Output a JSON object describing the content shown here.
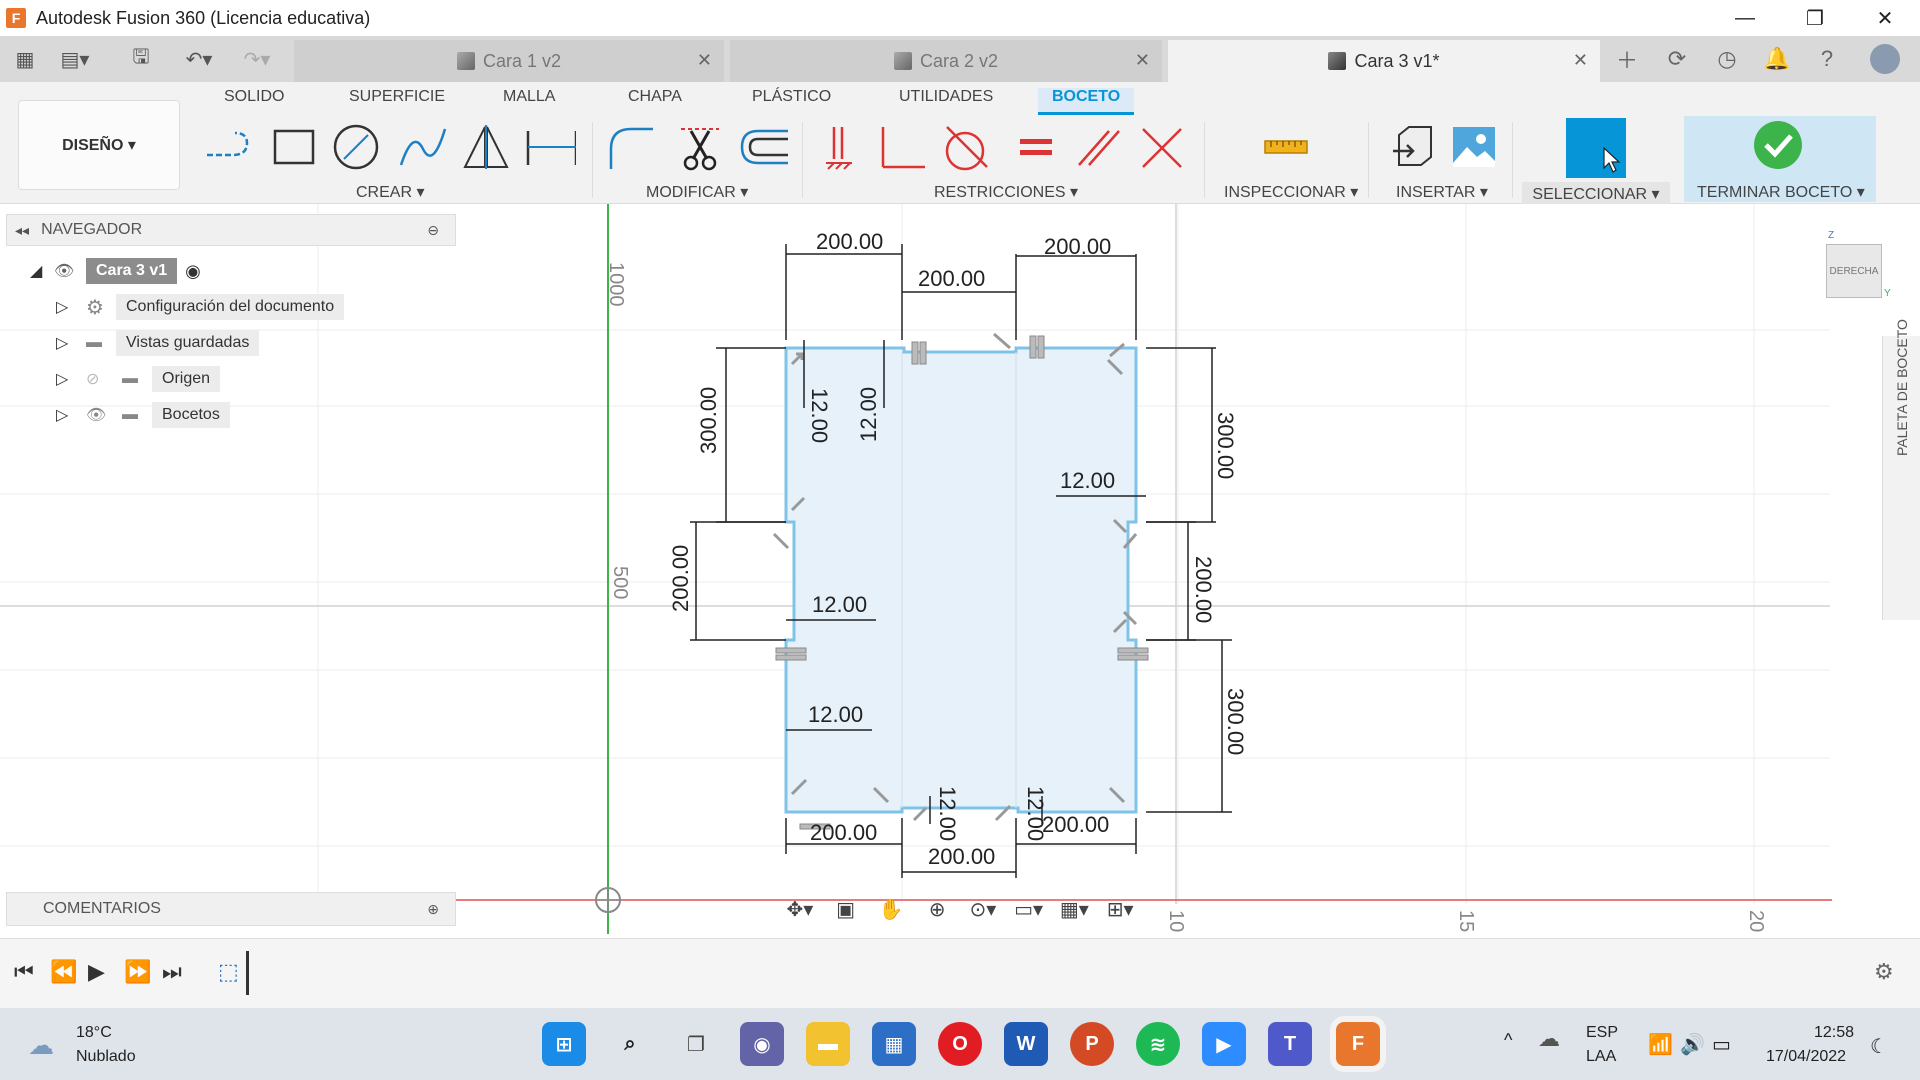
{
  "titlebar": {
    "title": "Autodesk Fusion 360 (Licencia educativa)",
    "app_icon": "F",
    "minimize": "—",
    "restore": "❐",
    "close": "✕"
  },
  "doc_tabs": [
    {
      "label": "Cara 1 v2",
      "active": false
    },
    {
      "label": "Cara 2 v2",
      "active": false
    },
    {
      "label": "Cara 3 v1*",
      "active": true
    }
  ],
  "ribbon": {
    "tabs": [
      "SOLIDO",
      "SUPERFICIE",
      "MALLA",
      "CHAPA",
      "PLÁSTICO",
      "UTILIDADES",
      "BOCETO"
    ],
    "active_tab": "BOCETO",
    "workspace": "DISEÑO ▾",
    "groups": [
      "CREAR ▾",
      "MODIFICAR ▾",
      "RESTRICCIONES ▾",
      "INSPECCIONAR ▾",
      "INSERTAR ▾",
      "SELECCIONAR ▾",
      "TERMINAR BOCETO ▾"
    ]
  },
  "browser": {
    "header": "NAVEGADOR",
    "items": [
      {
        "label": "Cara 3 v1",
        "root": true
      },
      {
        "label": "Configuración del documento"
      },
      {
        "label": "Vistas guardadas"
      },
      {
        "label": "Origen"
      },
      {
        "label": "Bocetos"
      }
    ]
  },
  "comments": {
    "label": "COMENTARIOS"
  },
  "viewcube": {
    "face": "DERECHA",
    "axis_z": "Z",
    "axis_y": "Y"
  },
  "palette": {
    "label": "PALETA DE BOCETO"
  },
  "sketch": {
    "dimensions": {
      "d1": "200.00",
      "d2": "200.00",
      "d3": "200.00",
      "d4": "300.00",
      "d5": "300.00",
      "d6": "200.00",
      "d7": "200.00",
      "d8": "300.00",
      "d9": "12.00",
      "d10": "12.00",
      "d11": "12.00",
      "d12": "12.00",
      "d13": "12.00",
      "d14": "12.00",
      "d15": "12.00",
      "d16": "200.00",
      "d17": "200.00",
      "d18": "200.00"
    },
    "ruler": {
      "v1000": "1000",
      "v500": "500",
      "h10": "10",
      "h15": "15",
      "h20": "20"
    },
    "colors": {
      "profile_fill": "#e6f1fa",
      "profile_stroke": "#7fc3e8",
      "axis_green": "#3cb44b",
      "axis_red": "#e05050",
      "grid": "#e8e8e8"
    }
  },
  "taskbar": {
    "weather_temp": "18°C",
    "weather_desc": "Nublado",
    "lang1": "ESP",
    "lang2": "LAA",
    "time": "12:58",
    "date": "17/04/2022"
  }
}
